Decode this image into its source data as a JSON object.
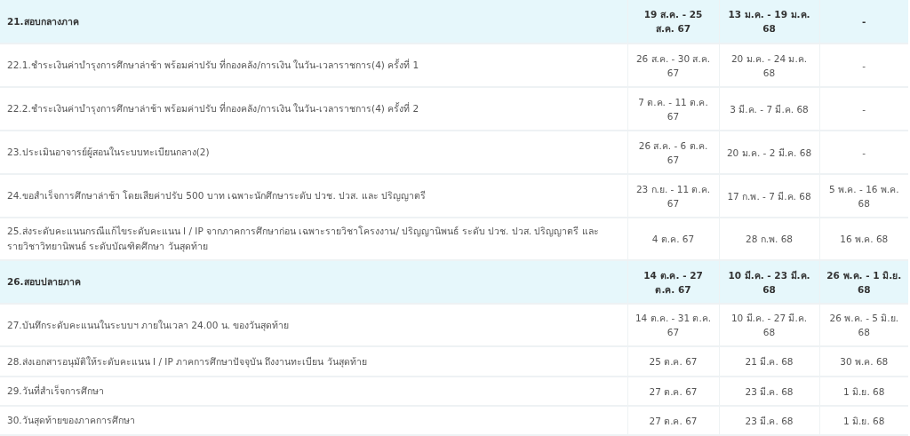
{
  "rows": [
    {
      "kind": "section",
      "label": "21.สอบกลางภาค",
      "dates": [
        "19 ส.ค. - 25 ส.ค. 67",
        "13 ม.ค. - 19 ม.ค. 68",
        "-"
      ]
    },
    {
      "kind": "item",
      "label": "22.1.ชำระเงินค่าบำรุงการศึกษาล่าช้า พร้อมค่าปรับ ที่กองคลัง/การเงิน ในวัน-เวลาราชการ(4) ครั้งที่ 1",
      "dates": [
        "26 ส.ค. - 30 ส.ค. 67",
        "20 ม.ค. - 24 ม.ค. 68",
        "-"
      ]
    },
    {
      "kind": "item",
      "label": "22.2.ชำระเงินค่าบำรุงการศึกษาล่าช้า พร้อมค่าปรับ ที่กองคลัง/การเงิน ในวัน-เวลาราชการ(4) ครั้งที่ 2",
      "dates": [
        "7 ต.ค. - 11 ต.ค. 67",
        "3 มี.ค. - 7 มี.ค. 68",
        "-"
      ]
    },
    {
      "kind": "item",
      "label": "23.ประเมินอาจารย์ผู้สอนในระบบทะเบียนกลาง(2)",
      "dates": [
        "26 ส.ค. - 6 ต.ค. 67",
        "20 ม.ค. - 2 มี.ค. 68",
        "-"
      ]
    },
    {
      "kind": "item",
      "label": "24.ขอสำเร็จการศึกษาล่าช้า โดยเสียค่าปรับ 500 บาท เฉพาะนักศึกษาระดับ ปวช. ปวส. และ ปริญญาตรี",
      "dates": [
        "23 ก.ย. - 11 ต.ค. 67",
        "17 ก.พ. - 7 มี.ค. 68",
        "5 พ.ค. - 16 พ.ค. 68"
      ]
    },
    {
      "kind": "item",
      "label": "25.ส่งระดับคะแนนกรณีแก้ไขระดับคะแนน I / IP จากภาคการศึกษาก่อน เฉพาะรายวิชาโครงงาน/ ปริญญานิพนธ์ ระดับ ปวช. ปวส. ปริญญาตรี และรายวิชาวิทยานิพนธ์ ระดับบัณฑิตศึกษา วันสุดท้าย",
      "dates": [
        "4 ต.ค. 67",
        "28 ก.พ. 68",
        "16 พ.ค. 68"
      ]
    },
    {
      "kind": "section",
      "label": "26.สอบปลายภาค",
      "dates": [
        "14 ต.ค. - 27 ต.ค. 67",
        "10 มี.ค. - 23 มี.ค. 68",
        "26 พ.ค. - 1 มิ.ย. 68"
      ]
    },
    {
      "kind": "item",
      "label": "27.บันทึกระดับคะแนนในระบบฯ ภายในเวลา 24.00 น. ของวันสุดท้าย",
      "dates": [
        "14 ต.ค. - 31 ต.ค. 67",
        "10 มี.ค. - 27 มี.ค. 68",
        "26 พ.ค. - 5 มิ.ย. 68"
      ]
    },
    {
      "kind": "item",
      "label": "28.ส่งเอกสารอนุมัติให้ระดับคะแนน I / IP ภาคการศึกษาปัจจุบัน ถึงงานทะเบียน วันสุดท้าย",
      "dates": [
        "25 ต.ค. 67",
        "21 มี.ค. 68",
        "30 พ.ค. 68"
      ]
    },
    {
      "kind": "item",
      "label": "29.วันที่สำเร็จการศึกษา",
      "dates": [
        "27 ต.ค. 67",
        "23 มี.ค. 68",
        "1 มิ.ย. 68"
      ]
    },
    {
      "kind": "item",
      "label": "30.วันสุดท้ายของภาคการศึกษา",
      "dates": [
        "27 ต.ค. 67",
        "23 มี.ค. 68",
        "1 มิ.ย. 68"
      ]
    }
  ]
}
